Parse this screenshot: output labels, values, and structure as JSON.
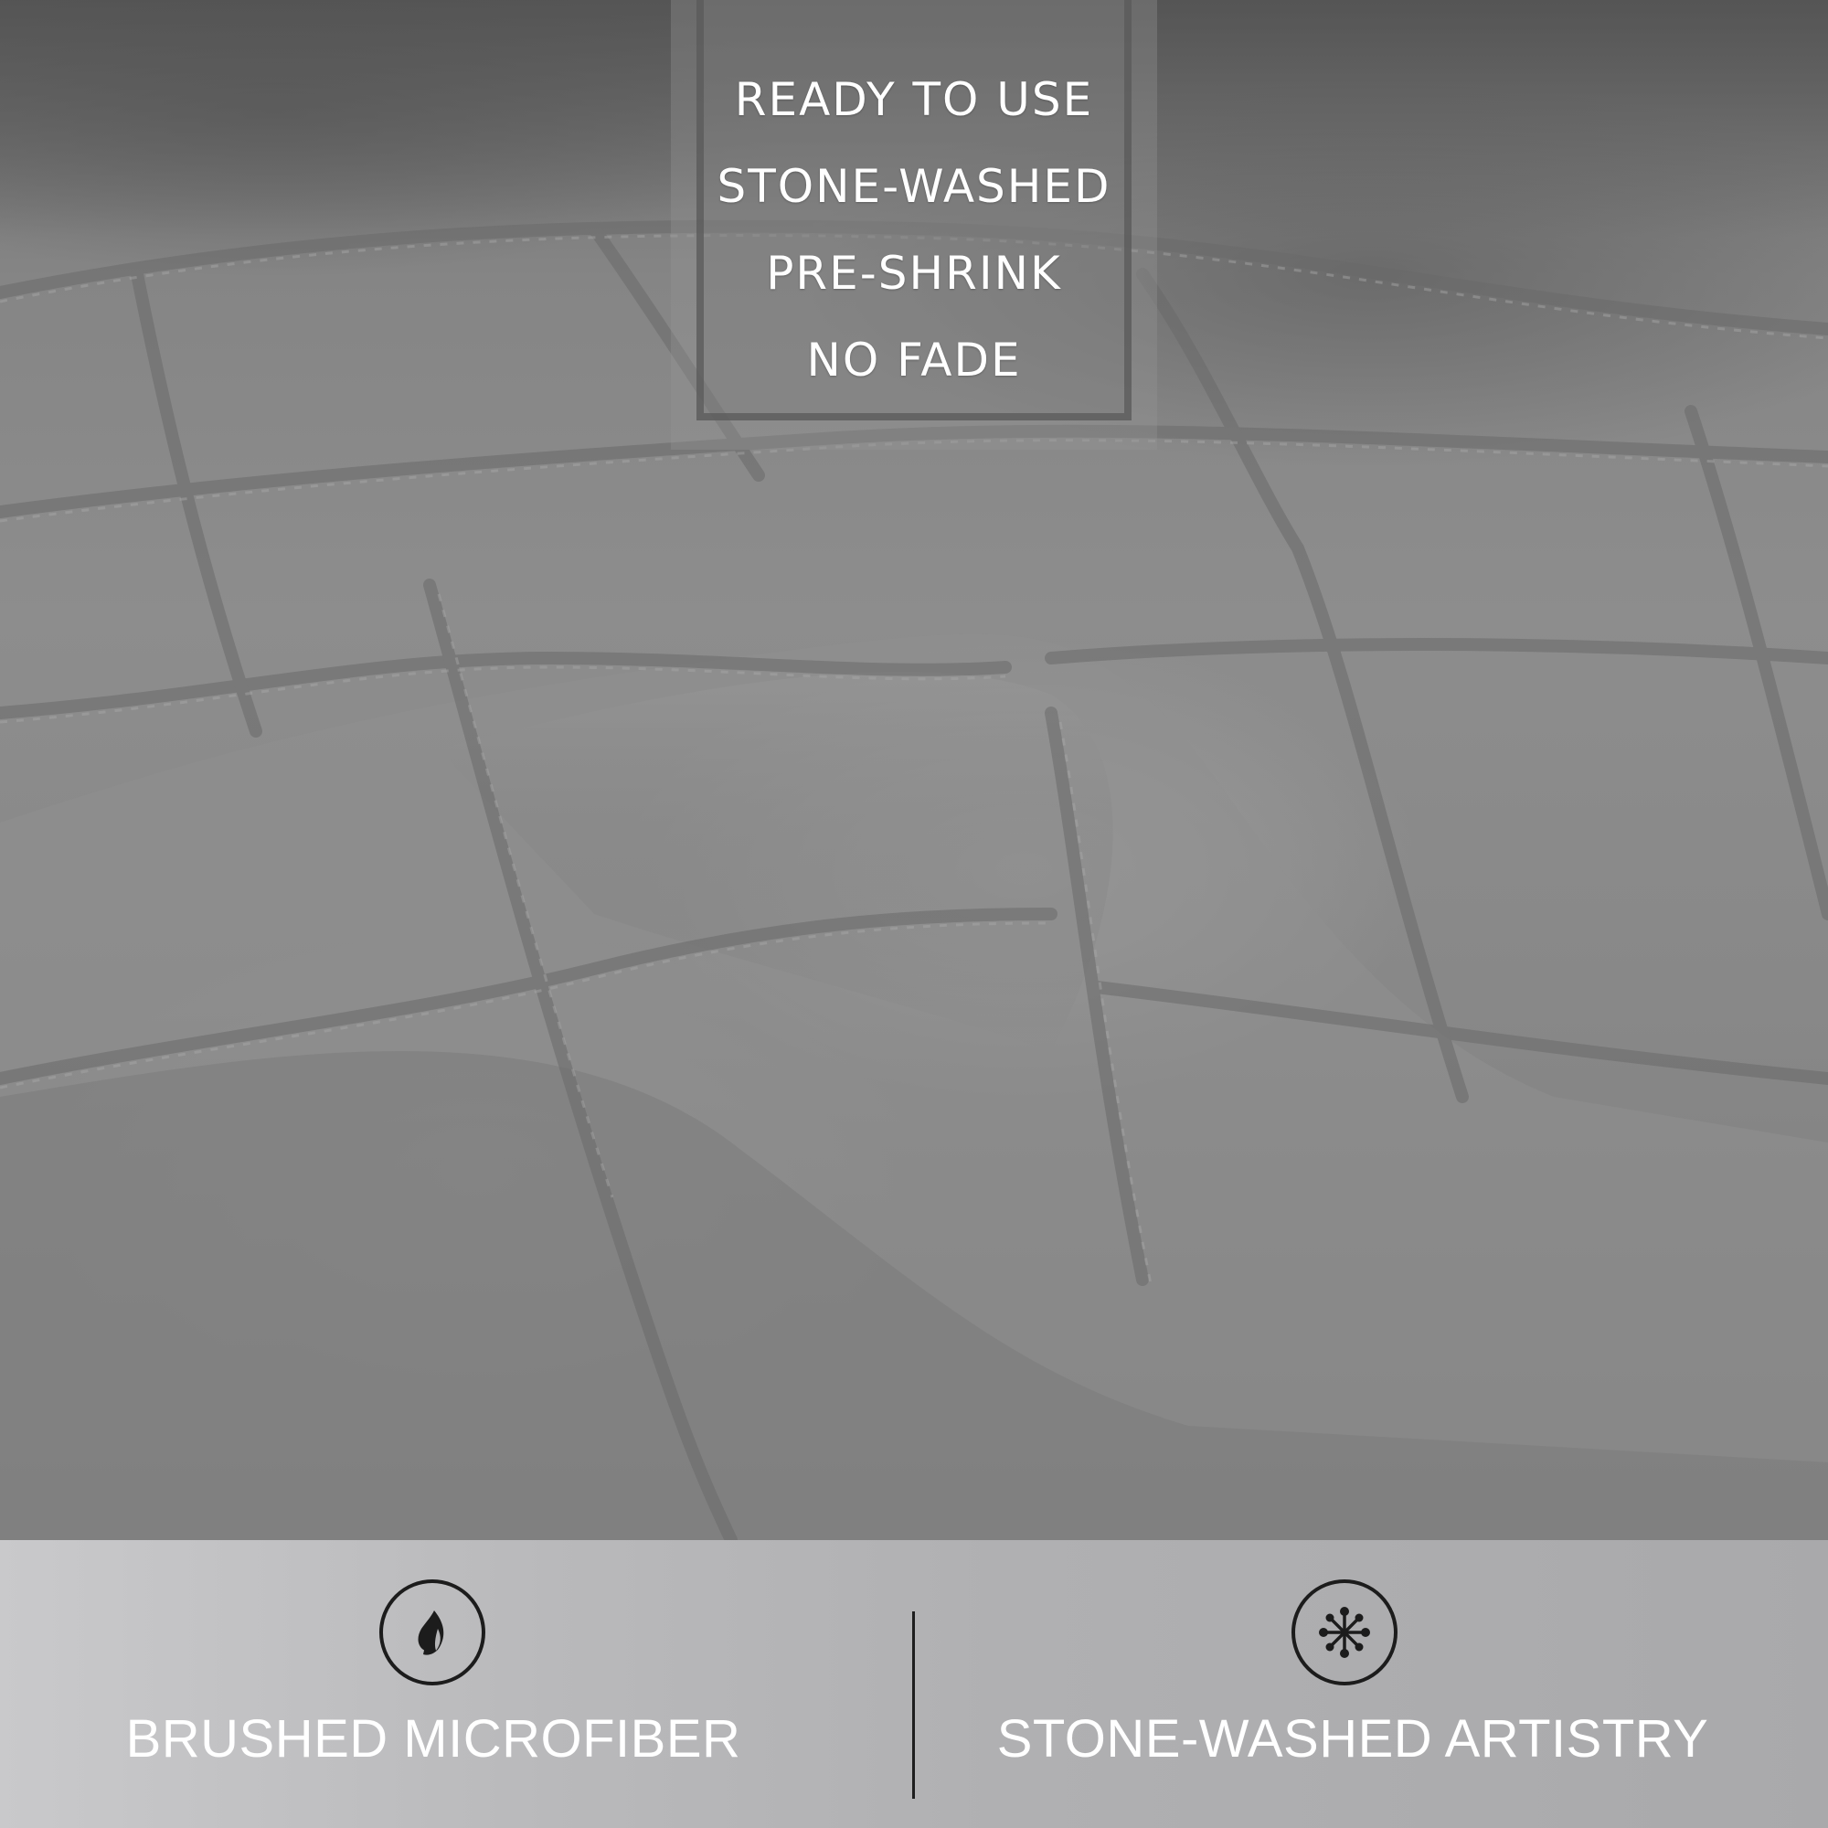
{
  "features": {
    "items": [
      "READY TO USE",
      "STONE-WASHED",
      "PRE-SHRINK",
      "NO FADE"
    ]
  },
  "badges": [
    {
      "icon": "leaf-flame-icon",
      "label": "BRUSHED MICROFIBER"
    },
    {
      "icon": "snowflake-icon",
      "label": "STONE-WASHED ARTISTRY"
    }
  ],
  "colors": {
    "fabric": "#8a8a8a",
    "band": "#b5b5b7",
    "text": "#ffffff",
    "icon": "#1c1c1c"
  }
}
